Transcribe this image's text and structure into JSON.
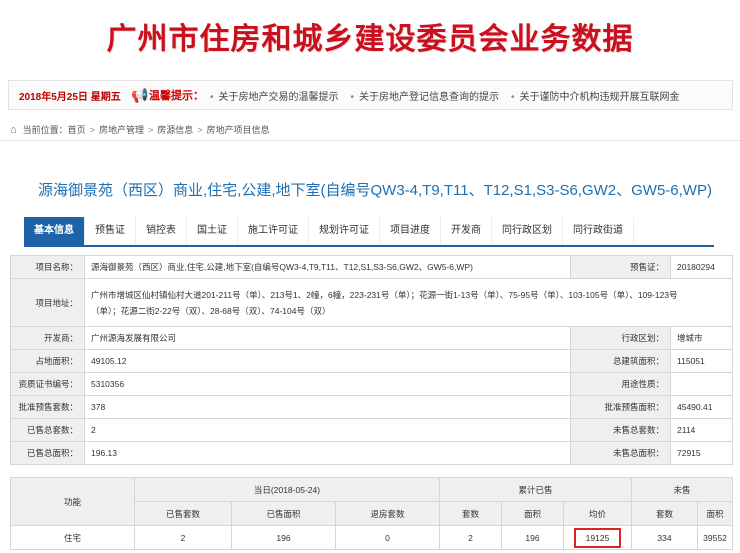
{
  "banner": {
    "title": "广州市住房和城乡建设委员会业务数据"
  },
  "notice": {
    "date": "2018年5月25日 星期五",
    "label": "温馨提示：",
    "items": [
      "关于房地产交易的温馨提示",
      "关于房地产登记信息查询的提示",
      "关于谨防中介机构违规开展互联网金"
    ]
  },
  "breadcrumb": {
    "prefix": "当前位置：",
    "items": [
      "首页",
      "房地产管理",
      "房源信息",
      "房地产项目信息"
    ]
  },
  "project": {
    "title": "源海御景苑（西区）商业,住宅,公建,地下室(自编号QW3-4,T9,T11、T12,S1,S3-S6,GW2、GW5-6,WP)"
  },
  "tabs": [
    "基本信息",
    "预售证",
    "销控表",
    "国土证",
    "施工许可证",
    "规划许可证",
    "项目进度",
    "开发商",
    "同行政区划",
    "同行政街道"
  ],
  "info": {
    "project_name_label": "项目名称：",
    "project_name": "源海御景苑（西区）商业,住宅,公建,地下室(自编号QW3-4,T9,T11、T12,S1,S3-S6,GW2、GW5-6,WP)",
    "presale_label": "预售证：",
    "presale": "20180294",
    "address_label": "项目地址：",
    "address_line1": "广州市增城区仙村镇仙村大道201-211号（单）、213号1、2幢，6幢，223-231号（单）；花源一街1-13号（单）、75-95号（单）、103-105号（单）、109-123号",
    "address_line2": "（单）；花源二街2-22号（双）、28-68号（双）、74-104号（双）",
    "developer_label": "开发商：",
    "developer": "广州源海发展有限公司",
    "district_label": "行政区划：",
    "district": "增城市",
    "land_area_label": "占地面积：",
    "land_area": "49105.12",
    "total_build_label": "总建筑面积：",
    "total_build": "115051",
    "cert_label": "资质证书编号：",
    "cert": "5310356",
    "usage_label": "用途性质：",
    "usage": "",
    "approved_units_label": "批准预售套数：",
    "approved_units": "378",
    "approved_area_label": "批准预售面积：",
    "approved_area": "45490.41",
    "sold_units_label": "已售总套数：",
    "sold_units": "2",
    "unsold_units_label": "未售总套数：",
    "unsold_units": "2114",
    "sold_area_label": "已售总面积：",
    "sold_area": "196.13",
    "unsold_area_label": "未售总面积：",
    "unsold_area": "72915"
  },
  "sales": {
    "function_label": "功能",
    "today_label": "当日(2018-05-24)",
    "cumulative_label": "累计已售",
    "unsold_label": "未售",
    "cols": [
      "已售套数",
      "已售面积",
      "退房套数",
      "套数",
      "面积",
      "均价",
      "套数",
      "面积"
    ],
    "row": {
      "name": "住宅",
      "values": [
        "2",
        "196",
        "0",
        "2",
        "196",
        "19125",
        "334",
        "39552"
      ]
    }
  }
}
